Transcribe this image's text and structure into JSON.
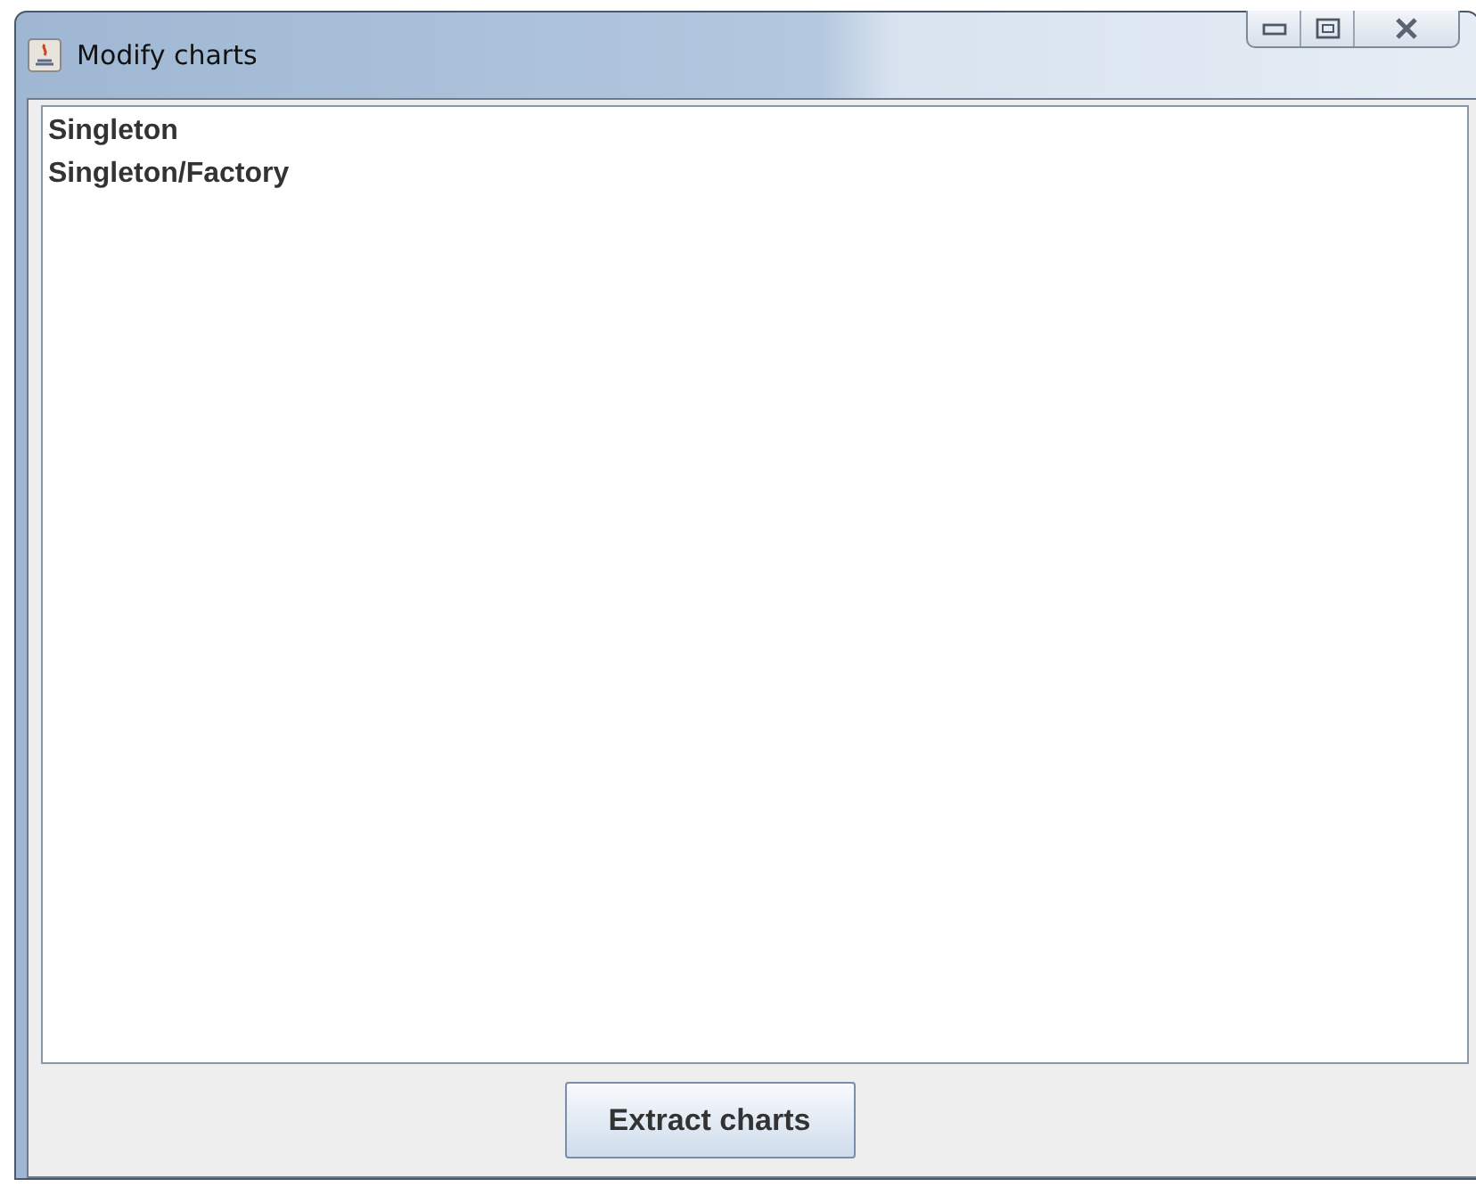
{
  "window": {
    "title": "Modify charts"
  },
  "list": {
    "items": [
      {
        "label": "Singleton"
      },
      {
        "label": "Singleton/Factory"
      }
    ]
  },
  "buttons": [
    {
      "label": "Extract charts"
    }
  ]
}
